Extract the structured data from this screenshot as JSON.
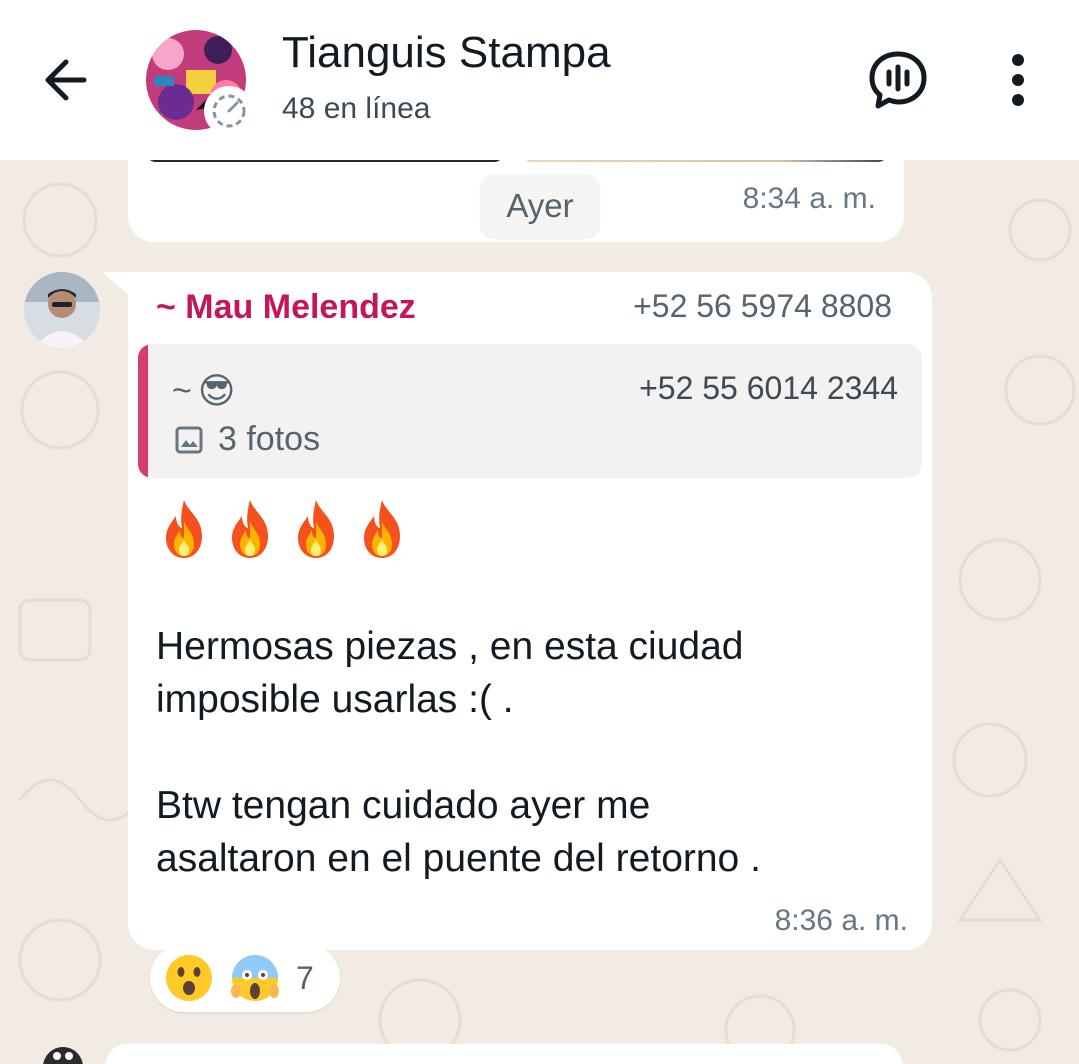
{
  "header": {
    "title": "Tianguis Stampa",
    "subtitle": "48 en línea",
    "back_icon": "arrow-left-icon",
    "voice_chat_icon": "voice-chat-icon",
    "menu_icon": "more-vertical-icon"
  },
  "previous_message": {
    "time": "8:34 a. m."
  },
  "date_separator": "Ayer",
  "message": {
    "sender_name": "~ Mau Melendez",
    "sender_phone": "+52 56 5974 8808",
    "quoted": {
      "name_prefix": "~",
      "name_emoji": "😎",
      "phone": "+52 55 6014 2344",
      "media_icon": "image-icon",
      "media_label": "3 fotos"
    },
    "emoji_line": [
      "🔥",
      "🔥",
      "🔥",
      "🔥"
    ],
    "text": "Hermosas piezas , en esta ciudad\nimposible usarlas :( .\n\nBtw tengan cuidado ayer me\nasaltaron en el puente del retorno .",
    "time": "8:36 a. m.",
    "reactions": {
      "emojis": [
        "😮",
        "😱"
      ],
      "count": "7"
    }
  },
  "colors": {
    "header_bg": "#ffffff",
    "chat_bg": "#f2ebe3",
    "sender_name": "#c2185b",
    "quote_bar": "#d63c6c",
    "meta_text": "#667781"
  }
}
